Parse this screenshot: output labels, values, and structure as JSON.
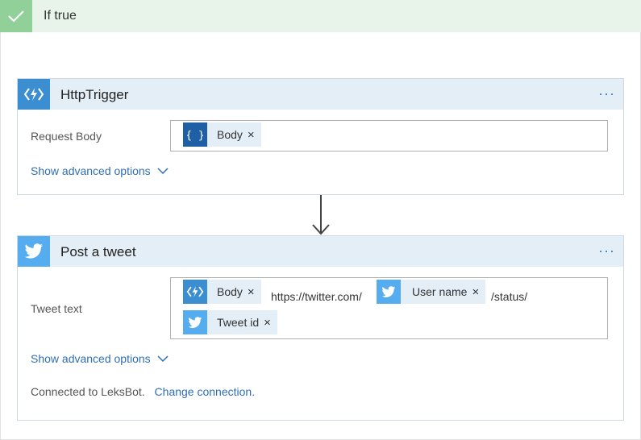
{
  "condition": {
    "title": "If true"
  },
  "http_card": {
    "title": "HttpTrigger",
    "more": "···",
    "field_label": "Request Body",
    "token_body": "Body",
    "remove": "×",
    "advanced": "Show advanced options"
  },
  "tweet_card": {
    "title": "Post a tweet",
    "more": "···",
    "field_label": "Tweet text",
    "token_body": "Body",
    "text_url": "https://twitter.com/",
    "token_user": "User name",
    "text_status": "/status/",
    "token_id": "Tweet id",
    "remove": "×",
    "advanced": "Show advanced options",
    "connected_text": "Connected to LeksBot.",
    "change_connection": "Change connection."
  },
  "colors": {
    "accent": "#2f6fb4",
    "success": "#92d09a",
    "azure": "#3b8fd1",
    "twitter": "#55acee",
    "json": "#1e5fa6"
  }
}
